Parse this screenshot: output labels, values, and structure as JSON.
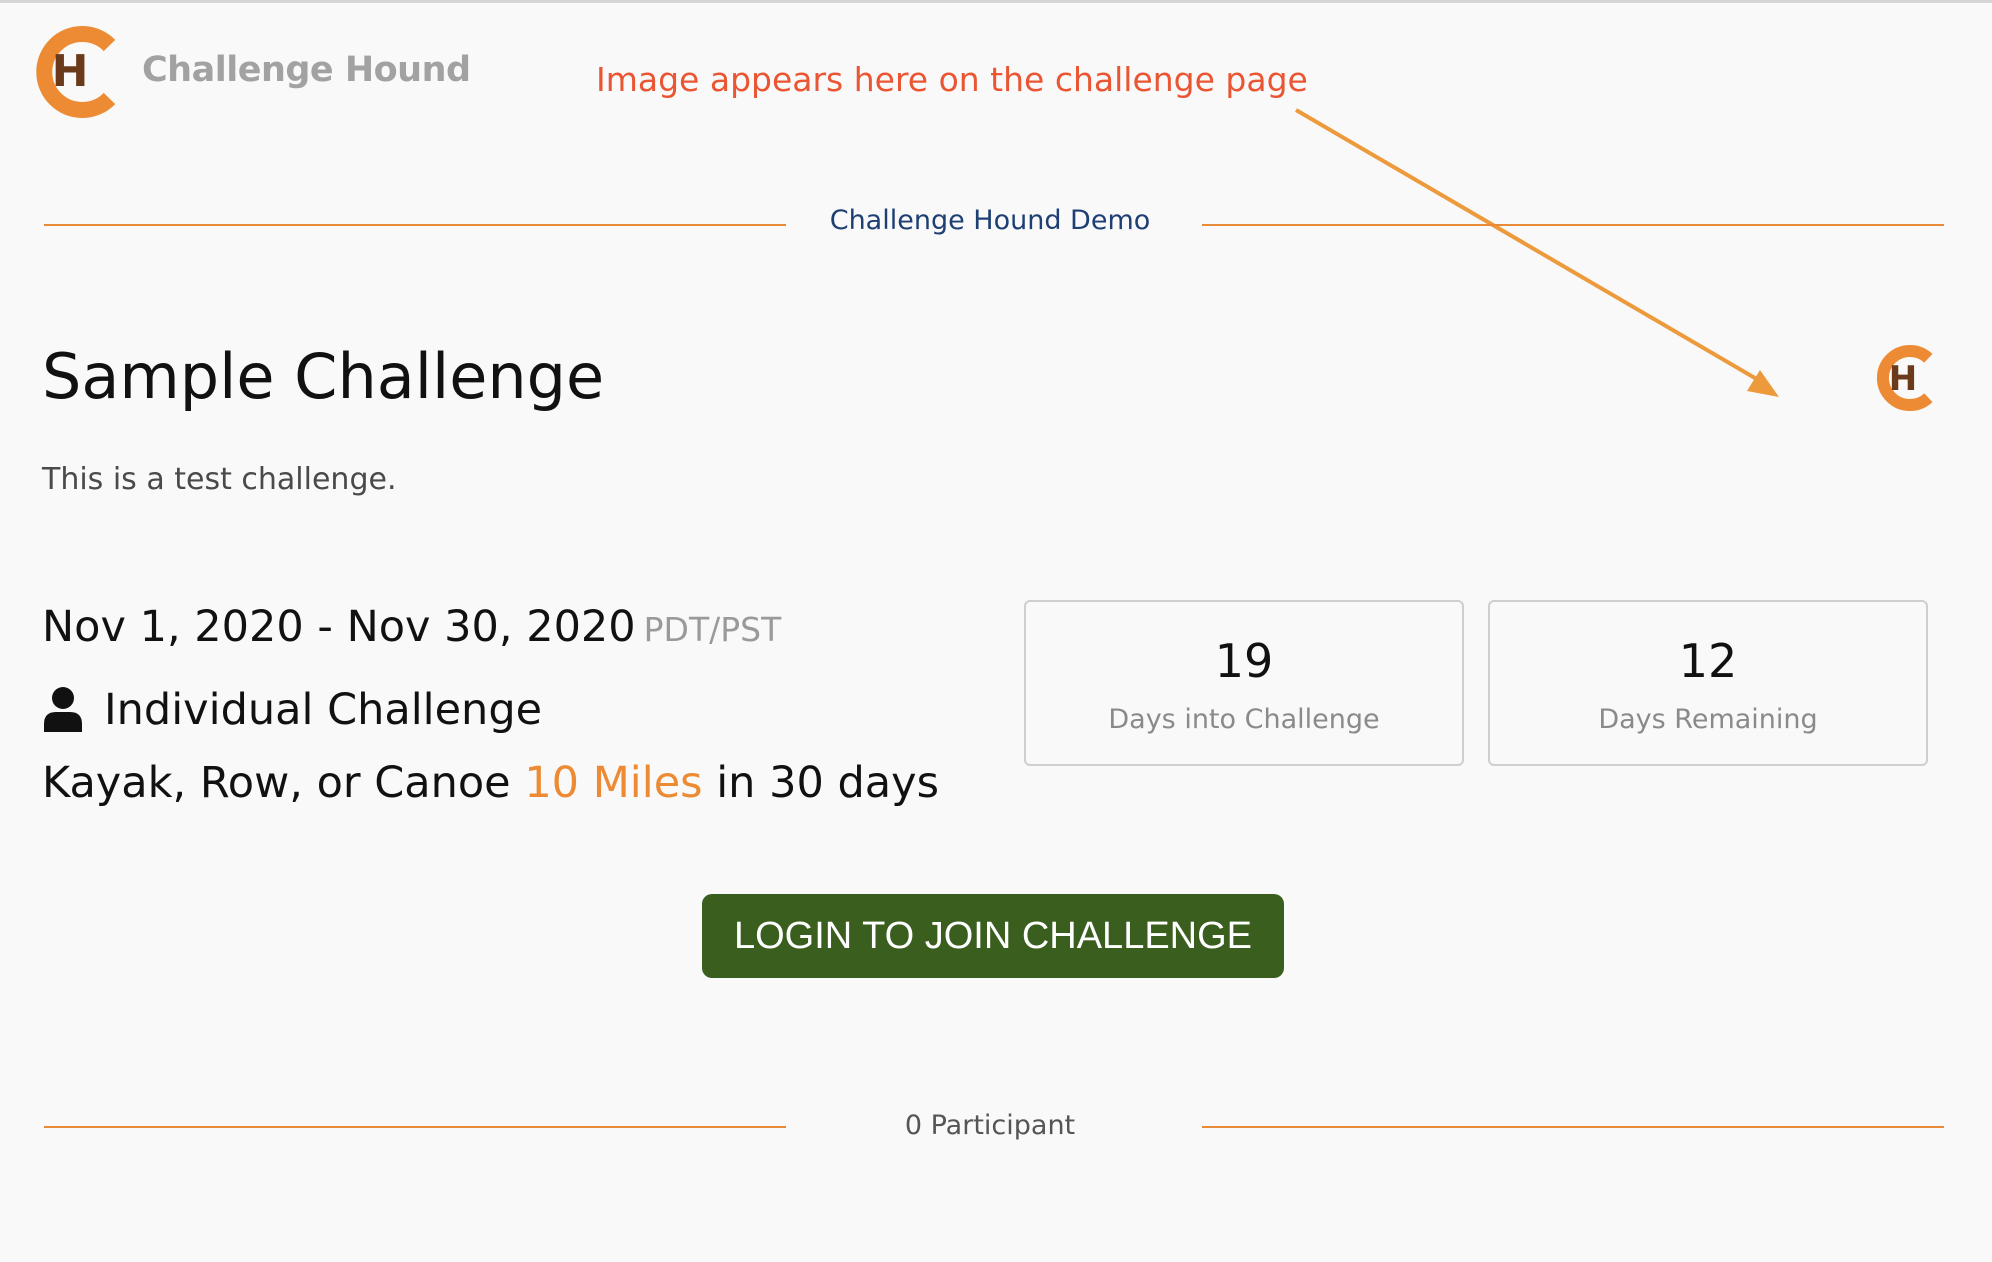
{
  "header": {
    "logo_letter": "H",
    "brand_name": "Challenge Hound"
  },
  "annotation": {
    "text": "Image appears here on the challenge page"
  },
  "organization": {
    "name": "Challenge Hound Demo"
  },
  "challenge": {
    "title": "Sample Challenge",
    "logo_letter": "H",
    "description": "This is a test challenge.",
    "date_range": "Nov 1, 2020 - Nov 30, 2020",
    "timezone": "PDT/PST",
    "type": "Individual Challenge",
    "goal_prefix": "Kayak, Row, or Canoe",
    "goal_distance": "10 Miles",
    "goal_suffix": "in 30 days"
  },
  "stats": {
    "days_into": {
      "value": "19",
      "label": "Days into Challenge"
    },
    "days_remaining": {
      "value": "12",
      "label": "Days Remaining"
    }
  },
  "actions": {
    "login_join_label": "LOGIN TO JOIN CHALLENGE"
  },
  "footer": {
    "participants": "0 Participant"
  },
  "colors": {
    "brand_orange": "#ec8b33",
    "annotation_red": "#ea5633",
    "divider_orange": "#e98a38",
    "org_blue": "#1e3f73",
    "button_green": "#3a5e1e",
    "logo_letter_brown": "#6b3a1b"
  },
  "icons": {
    "brand": "challenge-hound-logo-icon",
    "participant": "person-icon",
    "annotation": "arrow-icon"
  }
}
